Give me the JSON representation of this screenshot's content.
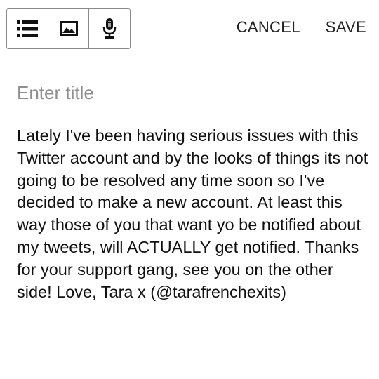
{
  "toolbar": {
    "icons": [
      "list-icon",
      "image-icon",
      "microphone-icon"
    ]
  },
  "actions": {
    "cancel_label": "CANCEL",
    "save_label": "SAVE"
  },
  "note": {
    "title_value": "",
    "title_placeholder": "Enter title",
    "body": "Lately I've been having serious issues with this Twitter account and by the looks of things its not going to be resolved any time soon so I've decided to make a new account. At least this way those of you that want yo be notified about my tweets, will ACTUALLY get notified. Thanks for your support gang, see you on the other side! Love, Tara x (@tarafrenchexits)"
  },
  "colors": {
    "text": "#111111",
    "placeholder": "#8f8f8f",
    "toolbar_border": "#8a8a8a",
    "icon": "#111111"
  }
}
